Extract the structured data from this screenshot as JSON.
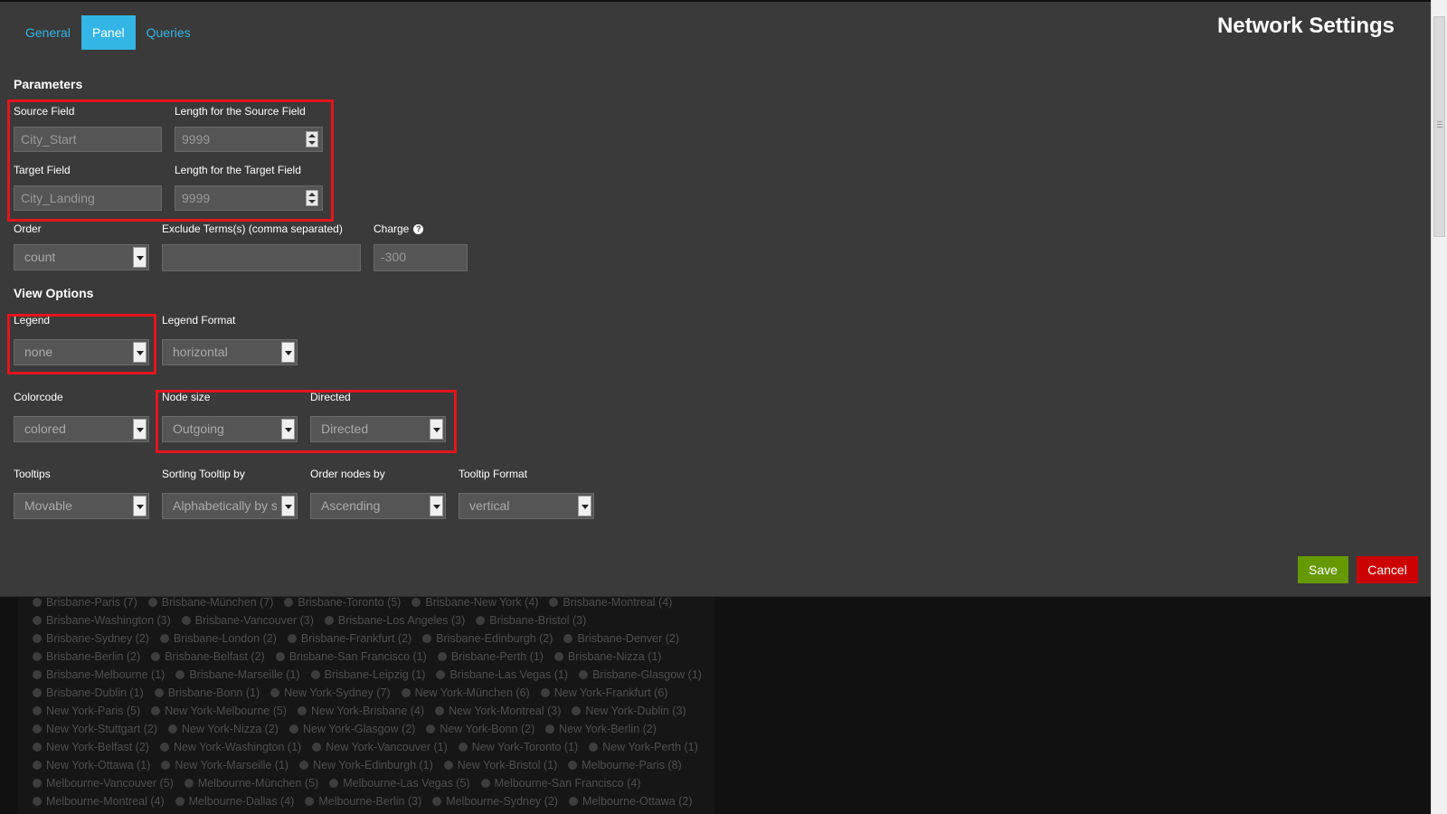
{
  "tabs": [
    {
      "label": "General",
      "active": false
    },
    {
      "label": "Panel",
      "active": true
    },
    {
      "label": "Queries",
      "active": false
    }
  ],
  "title": "Network Settings",
  "parameters": {
    "heading": "Parameters",
    "source_field": {
      "label": "Source Field",
      "value": "City_Start"
    },
    "source_length": {
      "label": "Length for the Source Field",
      "value": "9999"
    },
    "target_field": {
      "label": "Target Field",
      "value": "City_Landing"
    },
    "target_length": {
      "label": "Length for the Target Field",
      "value": "9999"
    },
    "order": {
      "label": "Order",
      "value": "count"
    },
    "exclude": {
      "label": "Exclude Terms(s) (comma separated)",
      "value": ""
    },
    "charge": {
      "label": "Charge",
      "value": "-300"
    }
  },
  "view_options": {
    "heading": "View Options",
    "legend": {
      "label": "Legend",
      "value": "none"
    },
    "legend_format": {
      "label": "Legend Format",
      "value": "horizontal"
    },
    "colorcode": {
      "label": "Colorcode",
      "value": "colored"
    },
    "node_size": {
      "label": "Node size",
      "value": "Outgoing"
    },
    "directed": {
      "label": "Directed",
      "value": "Directed"
    },
    "tooltips": {
      "label": "Tooltips",
      "value": "Movable"
    },
    "sorting_tooltip": {
      "label": "Sorting Tooltip by",
      "value": "Alphabetically by size"
    },
    "order_nodes": {
      "label": "Order nodes by",
      "value": "Ascending"
    },
    "tooltip_format": {
      "label": "Tooltip Format",
      "value": "vertical"
    }
  },
  "buttons": {
    "save": "Save",
    "cancel": "Cancel"
  },
  "background_legend": [
    [
      "Brisbane-Paris (7)",
      "Brisbane-München (7)",
      "Brisbane-Toronto (5)",
      "Brisbane-New York (4)",
      "Brisbane-Montreal (4)"
    ],
    [
      "Brisbane-Washington (3)",
      "Brisbane-Vancouver (3)",
      "Brisbane-Los Angeles (3)",
      "Brisbane-Bristol (3)"
    ],
    [
      "Brisbane-Sydney (2)",
      "Brisbane-London (2)",
      "Brisbane-Frankfurt (2)",
      "Brisbane-Edinburgh (2)",
      "Brisbane-Denver (2)"
    ],
    [
      "Brisbane-Berlin (2)",
      "Brisbane-Belfast (2)",
      "Brisbane-San Francisco (1)",
      "Brisbane-Perth (1)",
      "Brisbane-Nizza (1)"
    ],
    [
      "Brisbane-Melbourne (1)",
      "Brisbane-Marseille (1)",
      "Brisbane-Leipzig (1)",
      "Brisbane-Las Vegas (1)",
      "Brisbane-Glasgow (1)"
    ],
    [
      "Brisbane-Dublin (1)",
      "Brisbane-Bonn (1)",
      "New York-Sydney (7)",
      "New York-München (6)",
      "New York-Frankfurt (6)"
    ],
    [
      "New York-Paris (5)",
      "New York-Melbourne (5)",
      "New York-Brisbane (4)",
      "New York-Montreal (3)",
      "New York-Dublin (3)"
    ],
    [
      "New York-Stuttgart (2)",
      "New York-Nizza (2)",
      "New York-Glasgow (2)",
      "New York-Bonn (2)",
      "New York-Berlin (2)"
    ],
    [
      "New York-Belfast (2)",
      "New York-Washington (1)",
      "New York-Vancouver (1)",
      "New York-Toronto (1)",
      "New York-Perth (1)"
    ],
    [
      "New York-Ottawa (1)",
      "New York-Marseille (1)",
      "New York-Edinburgh (1)",
      "New York-Bristol (1)",
      "Melbourne-Paris (8)"
    ],
    [
      "Melbourne-Vancouver (5)",
      "Melbourne-München (5)",
      "Melbourne-Las Vegas (5)",
      "Melbourne-San Francisco (4)"
    ],
    [
      "Melbourne-Montreal (4)",
      "Melbourne-Dallas (4)",
      "Melbourne-Berlin (3)",
      "Melbourne-Sydney (2)",
      "Melbourne-Ottawa (2)"
    ]
  ]
}
